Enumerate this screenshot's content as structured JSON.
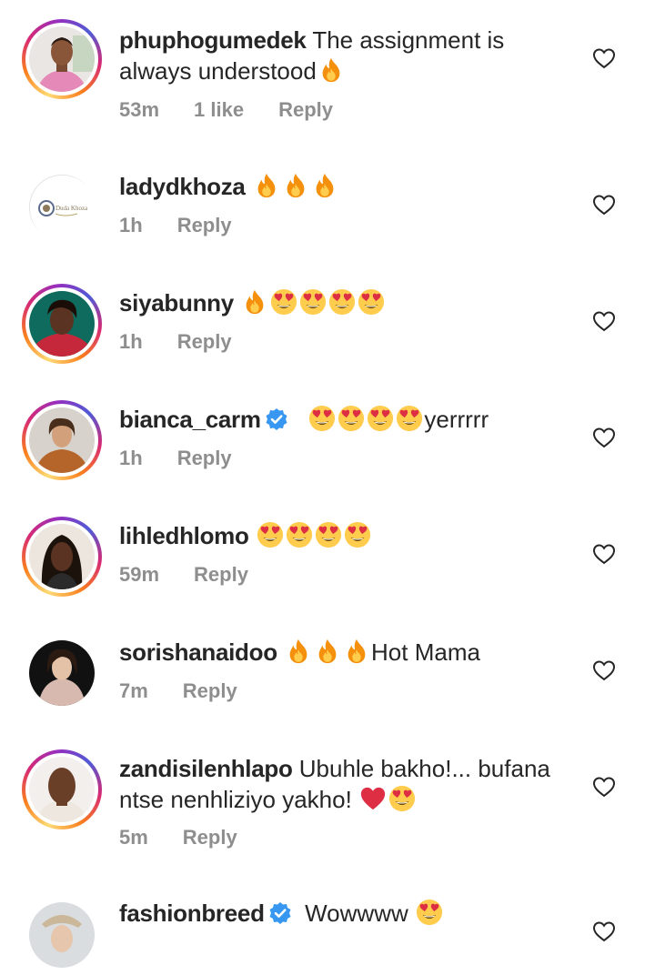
{
  "comments": [
    {
      "username": "phuphogumedek",
      "text": "The assignment is",
      "text2": "always understood",
      "time": "53m",
      "likes": "1 like",
      "reply": "Reply"
    },
    {
      "username": "ladydkhoza",
      "time": "1h",
      "reply": "Reply"
    },
    {
      "username": "siyabunny",
      "time": "1h",
      "reply": "Reply"
    },
    {
      "username": "bianca_carm",
      "text_after": "yerrrrr",
      "time": "1h",
      "reply": "Reply"
    },
    {
      "username": "lihledhlomo",
      "time": "59m",
      "reply": "Reply"
    },
    {
      "username": "sorishanaidoo",
      "text_after": "Hot Mama",
      "time": "7m",
      "reply": "Reply"
    },
    {
      "username": "zandisilenhlapo",
      "text": "Ubuhle bakho!... bufana",
      "text2": "ntse nenhliziyo yakho!",
      "time": "5m",
      "reply": "Reply"
    },
    {
      "username": "fashionbreed",
      "text": "Wowwww"
    }
  ],
  "avatar_logo_text": "Duda Khoza",
  "icons": {
    "emoji_fire": "fire-emoji",
    "emoji_heart_eyes": "heart-eyes-emoji",
    "emoji_red_heart": "red-heart-emoji",
    "verified": "verified-badge-icon",
    "like": "heart-outline-icon"
  },
  "colors": {
    "text": "#262626",
    "meta": "#8e8e8e",
    "verified": "#3897f0"
  }
}
